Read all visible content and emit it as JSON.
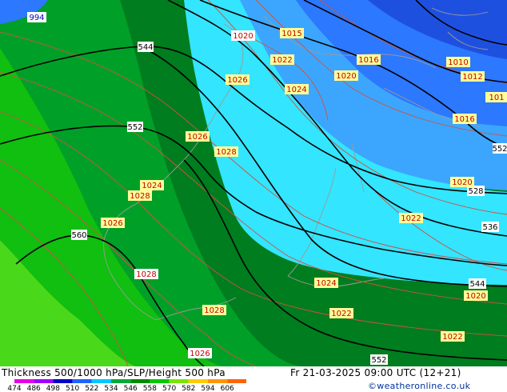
{
  "title": "Thickness 500/1000 hPa/SLP/Height 500 hPa",
  "valid_time": "Fr 21-03-2025 09:00 UTC (12+21)",
  "credit": "©weatheronline.co.uk",
  "colorbar": {
    "labels": [
      "474",
      "486",
      "498",
      "510",
      "522",
      "534",
      "546",
      "558",
      "570",
      "582",
      "594",
      "606"
    ],
    "colors": [
      "#e600e6",
      "#a000ff",
      "#0000c8",
      "#1e64ff",
      "#00c8ff",
      "#00aa3c",
      "#008c00",
      "#00c800",
      "#78e600",
      "#ffcc00",
      "#ff9600",
      "#ff6400"
    ]
  },
  "colors": {
    "thickness_dark_blue": "#1e50e0",
    "thickness_blue": "#2c78ff",
    "thickness_sky": "#3ca6ff",
    "thickness_cyan": "#33e5ff",
    "thickness_dark_green": "#007d1e",
    "thickness_green": "#00a028",
    "thickness_light_green": "#10bf10",
    "thickness_lime": "#4ad81a",
    "isobar": "#d05040",
    "height_contour": "#000000"
  },
  "height_labels": [
    "544",
    "552",
    "560",
    "528",
    "536",
    "544",
    "552",
    "552"
  ],
  "pressure_labels": [
    "1020",
    "1015",
    "1022",
    "1016",
    "1010",
    "1012",
    "1020",
    "1024",
    "1026",
    "1016",
    "1026",
    "1028",
    "1024",
    "1028",
    "1026",
    "1028",
    "1028",
    "1026",
    "1020",
    "1022",
    "1024",
    "1022",
    "1020",
    "1022",
    "101"
  ],
  "top_blue_label": "994"
}
